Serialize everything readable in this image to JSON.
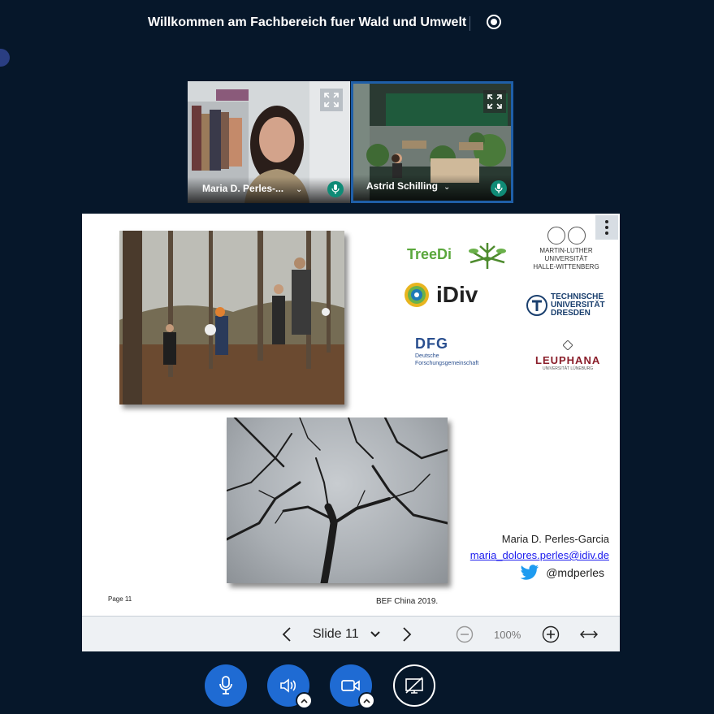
{
  "meeting": {
    "title": "Willkommen am Fachbereich fuer Wald und Umwelt"
  },
  "participants": [
    {
      "name": "Maria D. Perles-...",
      "chevron": "⌄"
    },
    {
      "name": "Astrid Schilling",
      "chevron": "⌄"
    }
  ],
  "slide": {
    "logos": {
      "treedi": "TreeDi",
      "idiv": "iDiv",
      "mlu": [
        "MARTIN-LUTHER",
        "UNIVERSITÄT",
        "HALLE-WITTENBERG"
      ],
      "tud": [
        "TECHNISCHE",
        "UNIVERSITÄT",
        "DRESDEN"
      ],
      "dfg": "DFG",
      "dfg_sub": [
        "Deutsche",
        "Forschungsgemeinschaft"
      ],
      "leuphana": "LEUPHANA",
      "leuphana_sub": "UNIVERSITÄT LÜNEBURG"
    },
    "author": "Maria D. Perles-Garcia",
    "email": "maria_dolores.perles@idiv.de",
    "twitter": "@mdperles",
    "page": "Page 11",
    "footer": "BEF China 2019."
  },
  "toolbar": {
    "slide_label": "Slide 11",
    "zoom": "100%"
  },
  "colors": {
    "background": "#06172a",
    "accent": "#1f6bd3",
    "active_border": "#1f5fa8",
    "mic_badge": "#0f8b76"
  },
  "icons": [
    "record-icon",
    "expand-icon",
    "mic-icon",
    "menu-icon",
    "chevron-left-icon",
    "chevron-right-icon",
    "zoom-out-icon",
    "zoom-in-icon",
    "fit-width-icon",
    "speaker-icon",
    "camera-icon",
    "share-screen-icon",
    "twitter-icon"
  ]
}
